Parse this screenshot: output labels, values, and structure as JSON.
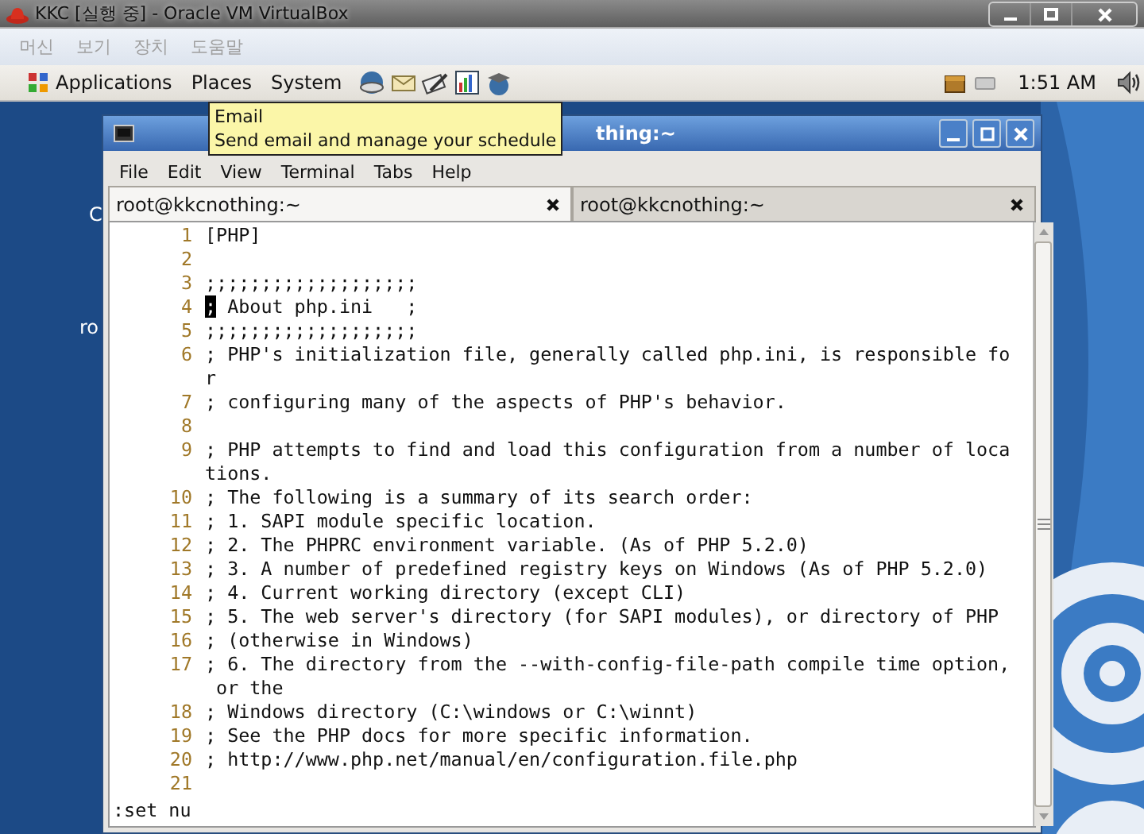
{
  "host_window": {
    "title": "KKC [실행 중] - Oracle VM VirtualBox"
  },
  "host_menu": [
    {
      "label": "머신",
      "disabled": true
    },
    {
      "label": "보기",
      "disabled": true
    },
    {
      "label": "장치",
      "disabled": true
    },
    {
      "label": "도움말",
      "disabled": true
    }
  ],
  "panel": {
    "menus": [
      "Applications",
      "Places",
      "System"
    ],
    "clock": "1:51 AM"
  },
  "tooltip": {
    "title": "Email",
    "text": "Send email and manage your schedule"
  },
  "desktop": {
    "labels": [
      "C",
      "ro"
    ]
  },
  "terminal": {
    "title": "thing:~",
    "menu": [
      "File",
      "Edit",
      "View",
      "Terminal",
      "Tabs",
      "Help"
    ],
    "tabs": [
      {
        "label": "root@kkcnothing:~",
        "selected": true
      },
      {
        "label": "root@kkcnothing:~",
        "selected": false
      }
    ],
    "lines": [
      {
        "number": "1",
        "text": "[PHP]",
        "cursor": false
      },
      {
        "number": "2",
        "cursor": false
      },
      {
        "number": "3",
        "text": ";;;;;;;;;;;;;;;;;;;",
        "cursor": false
      },
      {
        "number": "4",
        "text": "; About php.ini   ;",
        "cursor": true
      },
      {
        "number": "5",
        "text": ";;;;;;;;;;;;;;;;;;;",
        "cursor": false
      },
      {
        "number": "6",
        "text": "; PHP's initialization file, generally called php.ini, is responsible for",
        "cursor": false
      },
      {
        "number": "7",
        "text": "; configuring many of the aspects of PHP's behavior.",
        "cursor": false
      },
      {
        "number": "8",
        "cursor": false
      },
      {
        "number": "9",
        "text": "; PHP attempts to find and load this configuration from a number of locations.",
        "cursor": false
      },
      {
        "number": "10",
        "text": "; The following is a summary of its search order:",
        "cursor": false
      },
      {
        "number": "11",
        "text": "; 1. SAPI module specific location.",
        "cursor": false
      },
      {
        "number": "12",
        "text": "; 2. The PHPRC environment variable. (As of PHP 5.2.0)",
        "cursor": false
      },
      {
        "number": "13",
        "text": "; 3. A number of predefined registry keys on Windows (As of PHP 5.2.0)",
        "cursor": false
      },
      {
        "number": "14",
        "text": "; 4. Current working directory (except CLI)",
        "cursor": false
      },
      {
        "number": "15",
        "text": "; 5. The web server's directory (for SAPI modules), or directory of PHP",
        "cursor": false
      },
      {
        "number": "16",
        "text": "; (otherwise in Windows)",
        "cursor": false
      },
      {
        "number": "17",
        "text": "; 6. The directory from the --with-config-file-path compile time option, or the",
        "cursor": false
      },
      {
        "number": "18",
        "text": "; Windows directory (C:\\windows or C:\\winnt)",
        "cursor": false
      },
      {
        "number": "19",
        "text": "; See the PHP docs for more specific information.",
        "cursor": false
      },
      {
        "number": "20",
        "text": "; http://www.php.net/manual/en/configuration.file.php",
        "cursor": false
      },
      {
        "number": "21",
        "cursor": false
      }
    ],
    "command": ":set nu"
  }
}
